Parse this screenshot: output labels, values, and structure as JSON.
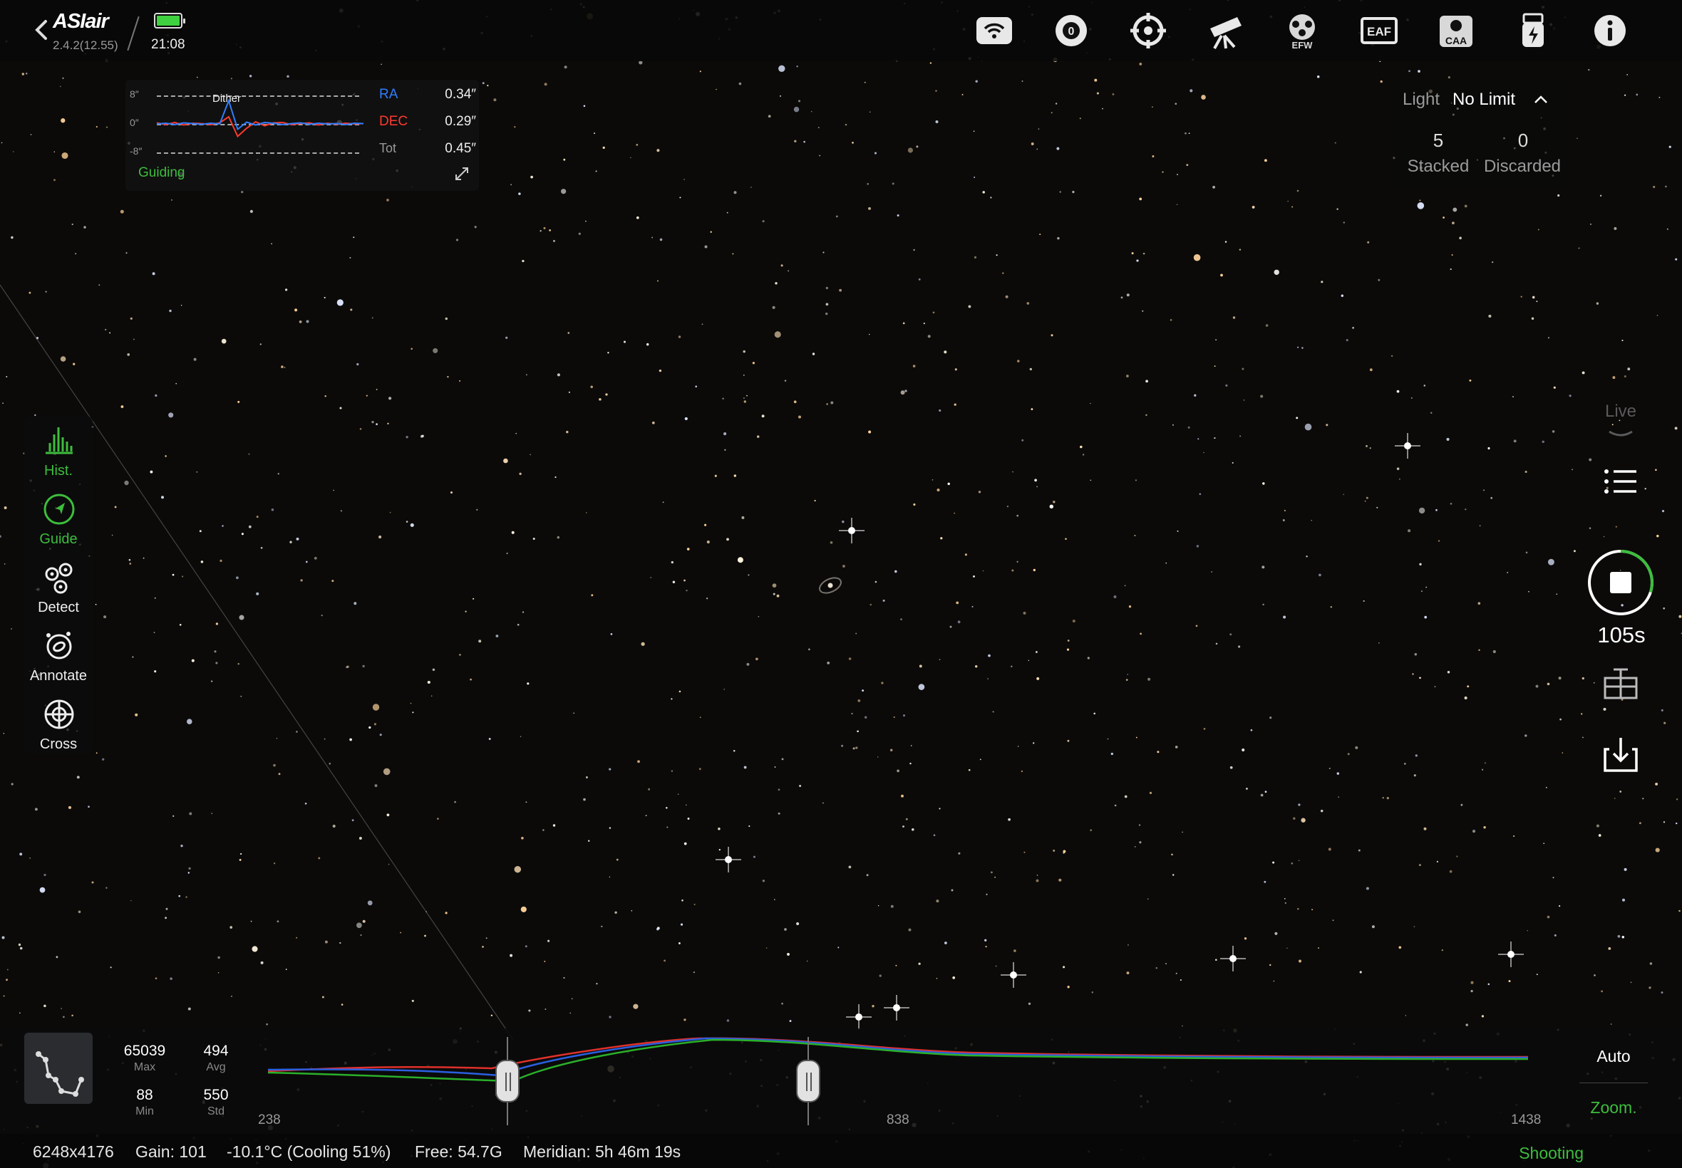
{
  "app": {
    "name": "ASIair",
    "version": "2.4.2(12.55)",
    "time": "21:08",
    "battery_color": "#3fd13f"
  },
  "top_icons": [
    "wifi-icon",
    "camera-icon",
    "guide-scope-icon",
    "telescope-icon",
    "filter-wheel-icon",
    "focuser-icon",
    "rotator-icon",
    "usb-storage-icon",
    "info-icon"
  ],
  "top_icon_labels": {
    "efw": "EFW",
    "eaf": "EAF",
    "caa": "CAA"
  },
  "guiding": {
    "y_labels": [
      "8″",
      "0″",
      "-8″"
    ],
    "dither_label": "Dither",
    "rows": [
      {
        "label": "RA",
        "value": "0.34″",
        "color": "#2f7fff"
      },
      {
        "label": "DEC",
        "value": "0.29″",
        "color": "#ff3a2e"
      },
      {
        "label": "Tot",
        "value": "0.45″",
        "color": "#9a9a9a"
      }
    ],
    "status": "Guiding",
    "ra_error": [
      0,
      0.2,
      -0.2,
      0.3,
      0.1,
      -0.1,
      0.2,
      0,
      6.5,
      -1.5,
      0.5,
      -0.3,
      0.4,
      0.2,
      -0.2,
      0.1,
      0.3,
      -0.1,
      0.2,
      0,
      0.1,
      -0.2,
      0.2,
      0.1
    ],
    "dec_error": [
      0.3,
      -0.2,
      0.4,
      -0.3,
      0.2,
      0.1,
      -0.2,
      0.3,
      2,
      -3.5,
      -1.2,
      0.6,
      -0.5,
      0.3,
      0.4,
      -0.2,
      0.1,
      0.3,
      -0.3,
      0.2,
      -0.1,
      0.2,
      0,
      0.1
    ]
  },
  "session": {
    "frame_type": "Light",
    "limit": "No Limit",
    "stacked": "5",
    "stacked_label": "Stacked",
    "discarded": "0",
    "discarded_label": "Discarded"
  },
  "left_tools": [
    {
      "name": "histogram",
      "label": "Hist.",
      "active": true
    },
    {
      "name": "guide",
      "label": "Guide",
      "active": true
    },
    {
      "name": "detect",
      "label": "Detect",
      "active": false
    },
    {
      "name": "annotate",
      "label": "Annotate",
      "active": false
    },
    {
      "name": "crosshair",
      "label": "Cross",
      "active": false
    }
  ],
  "right_tools": {
    "live_label": "Live",
    "exposure_remaining": "105s",
    "progress": 0.3
  },
  "histogram": {
    "stats": [
      {
        "label": "Max",
        "value": "65039"
      },
      {
        "label": "Avg",
        "value": "494"
      },
      {
        "label": "Min",
        "value": "88"
      },
      {
        "label": "Std",
        "value": "550"
      }
    ],
    "axis_labels": [
      "238",
      "838",
      "1438"
    ],
    "black_point": 238,
    "white_point": 838,
    "auto_label": "Auto",
    "zoom_label": "Zoom."
  },
  "status": {
    "resolution": "6248x4176",
    "gain": "Gain: 101",
    "temperature": "-10.1°C (Cooling 51%)",
    "free_space": "Free: 54.7G",
    "meridian": "Meridian: 5h 46m 19s",
    "state": "Shooting"
  }
}
